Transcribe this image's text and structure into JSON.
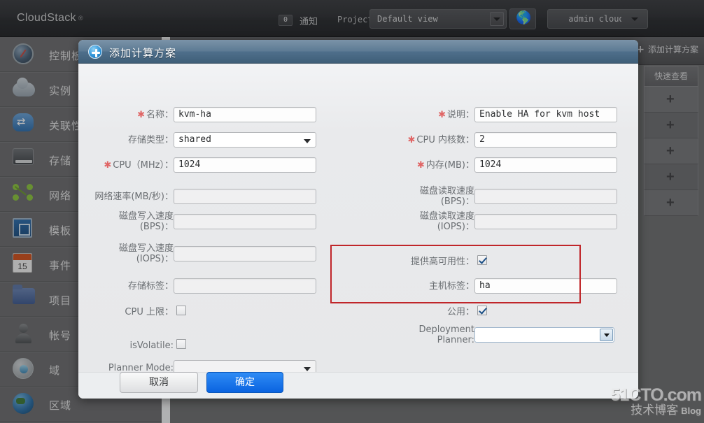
{
  "topbar": {
    "logo": "CloudStack",
    "logo_reg": "®",
    "notification_count": "0",
    "notification_label": "通知",
    "project_label": "Project:",
    "project_value": "Default view",
    "globe_icon": "globe-icon",
    "user_name": "admin cloud"
  },
  "sidebar": {
    "items": [
      {
        "label": "控制板",
        "icon": "gauge-icon"
      },
      {
        "label": "实例",
        "icon": "cloud-icon"
      },
      {
        "label": "关联性",
        "icon": "affinity-icon"
      },
      {
        "label": "存储",
        "icon": "storage-icon"
      },
      {
        "label": "网络",
        "icon": "network-icon"
      },
      {
        "label": "模板",
        "icon": "template-icon"
      },
      {
        "label": "事件",
        "icon": "calendar-icon"
      },
      {
        "label": "项目",
        "icon": "folder-icon"
      },
      {
        "label": "帐号",
        "icon": "user-icon"
      },
      {
        "label": "域",
        "icon": "domain-icon"
      },
      {
        "label": "区域",
        "icon": "region-icon"
      }
    ]
  },
  "background": {
    "add_button": "添加计算方案",
    "quick_view_header": "快速查看",
    "quick_view_rows": [
      "+",
      "+",
      "+",
      "+",
      "+"
    ]
  },
  "dialog": {
    "title": "添加计算方案",
    "title_icon": "plus-circle-icon",
    "left_fields": [
      {
        "label": "名称：",
        "required": true,
        "type": "text",
        "value": "kvm-ha"
      },
      {
        "label": "存储类型：",
        "required": false,
        "type": "select",
        "value": "shared"
      },
      {
        "label": "CPU（MHz）：",
        "required": true,
        "type": "text",
        "value": "1024"
      },
      {
        "label": "网络速率(MB/秒)：",
        "required": false,
        "type": "text",
        "value": ""
      },
      {
        "label": "磁盘写入速度",
        "label2": "(BPS)：",
        "required": false,
        "type": "text",
        "value": ""
      },
      {
        "label": "磁盘写入速度",
        "label2": "(IOPS)：",
        "required": false,
        "type": "text",
        "value": ""
      },
      {
        "label": "存储标签：",
        "required": false,
        "type": "text",
        "value": ""
      },
      {
        "label": "CPU 上限：",
        "required": false,
        "type": "checkbox",
        "checked": false
      },
      {
        "label": "isVolatile:",
        "required": false,
        "type": "checkbox",
        "checked": false
      },
      {
        "label": "Planner Mode:",
        "required": false,
        "type": "select",
        "value": ""
      }
    ],
    "right_fields": [
      {
        "label": "说明：",
        "required": true,
        "type": "text",
        "value": "Enable HA for kvm host"
      },
      {
        "label": "CPU 内核数：",
        "required": true,
        "type": "text",
        "value": "2"
      },
      {
        "label": "内存(MB)：",
        "required": true,
        "type": "text",
        "value": "1024"
      },
      {
        "label": "磁盘读取速度",
        "label2": "(BPS)：",
        "required": false,
        "type": "text",
        "value": ""
      },
      {
        "label": "磁盘读取速度",
        "label2": "(IOPS)：",
        "required": false,
        "type": "text",
        "value": ""
      },
      {
        "label": "提供高可用性：",
        "required": false,
        "type": "checkbox",
        "checked": true
      },
      {
        "label": "主机标签：",
        "required": false,
        "type": "text",
        "value": "ha"
      },
      {
        "label": "公用：",
        "required": false,
        "type": "checkbox",
        "checked": true
      },
      {
        "label": "Deployment",
        "label2": "Planner:",
        "required": false,
        "type": "combo",
        "value": ""
      }
    ],
    "highlight_color": "#c0262a",
    "cancel_label": "取消",
    "ok_label": "确定"
  },
  "watermark": {
    "line1": "51CTO.com",
    "line2": "技术博客",
    "line2_suffix": "Blog"
  }
}
